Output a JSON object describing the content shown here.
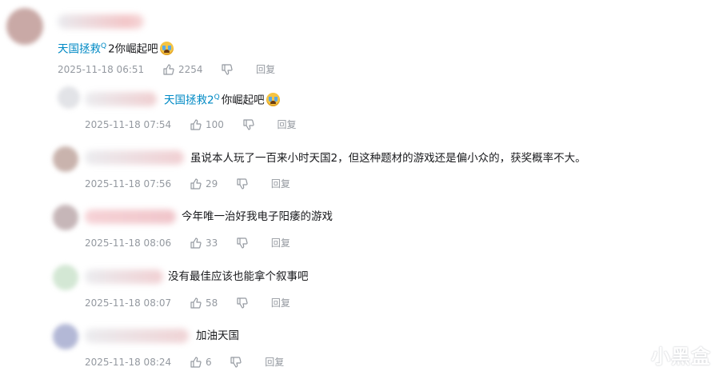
{
  "comments": [
    {
      "link_text": "天国拯救",
      "sup": "Q",
      "text": "2你崛起吧",
      "emoji": "crying-face",
      "time": "2025-11-18 06:51",
      "likes": "2254",
      "reply": "回复"
    },
    {
      "link_text": "天国拯救2",
      "sup": "Q",
      "text": "你崛起吧",
      "emoji": "crying-face",
      "time": "2025-11-18 07:54",
      "likes": "100",
      "reply": "回复"
    },
    {
      "text": "虽说本人玩了一百来小时天国2，但这种题材的游戏还是偏小众的，获奖概率不大。",
      "time": "2025-11-18 07:56",
      "likes": "29",
      "reply": "回复"
    },
    {
      "text": "今年唯一治好我电子阳痿的游戏",
      "time": "2025-11-18 08:06",
      "likes": "33",
      "reply": "回复"
    },
    {
      "text": "没有最佳应该也能拿个叙事吧",
      "time": "2025-11-18 08:07",
      "likes": "58",
      "reply": "回复"
    },
    {
      "text": "加油天国",
      "time": "2025-11-18 08:24",
      "likes": "6",
      "reply": "回复"
    }
  ],
  "watermark": "小黑盒",
  "colors": {
    "link": "#008ac5",
    "meta": "#9499a0",
    "text": "#18191c"
  }
}
